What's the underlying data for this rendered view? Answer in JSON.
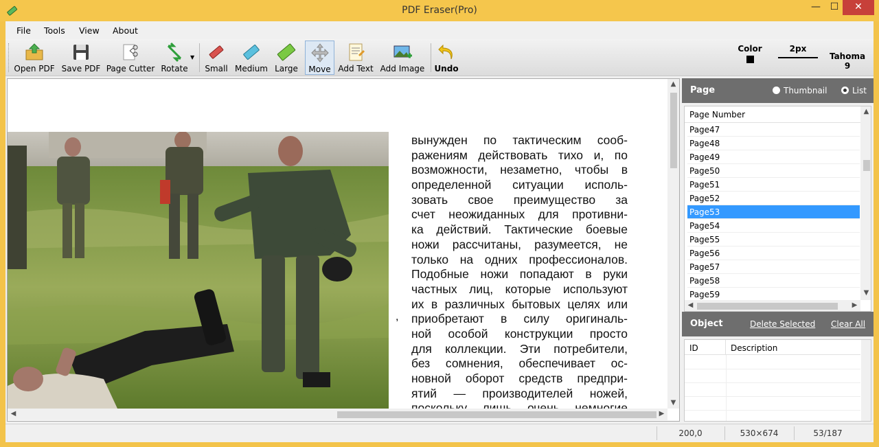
{
  "window": {
    "title": "PDF Eraser(Pro)",
    "minimize": "—",
    "maximize": "☐",
    "close": "✕"
  },
  "menu": [
    "File",
    "Tools",
    "View",
    "About"
  ],
  "toolbar": {
    "open_pdf": "Open PDF",
    "save_pdf": "Save PDF",
    "page_cutter": "Page Cutter",
    "rotate": "Rotate",
    "small": "Small",
    "medium": "Medium",
    "large": "Large",
    "move": "Move",
    "add_text": "Add Text",
    "add_image": "Add Image",
    "undo": "Undo",
    "color_label": "Color",
    "color_value": "#000000",
    "stroke_label": "2px",
    "font_label": "Tahoma 9"
  },
  "document": {
    "lines": [
      "вынужден по тактическим сооб-",
      "ражениям действовать тихо и, по",
      "возможности, незаметно, чтобы в",
      "определенной ситуации исполь-",
      "зовать свое преимущество за",
      "счет неожиданных для противни-",
      "ка действий. Тактические боевые",
      "ножи рассчитаны, разумеется, не",
      "только на одних профессионалов.",
      "Подобные ножи попадают в руки",
      "частных лиц, которые используют",
      "их в различных бытовых целях или",
      "приобретают в силу оригиналь-",
      "ной особой конструкции просто",
      "для коллекции. Эти потребители,",
      "без сомнения, обеспечивает ос-",
      "новной оборот средств предпри-",
      "ятий — производителей ножей,",
      "поскольку лишь очень немногие"
    ],
    "stray_comma": ","
  },
  "page_panel": {
    "title": "Page",
    "view_thumbnail": "Thumbnail",
    "view_list": "List",
    "selected_view": "List",
    "column_header": "Page Number",
    "pages": [
      "Page47",
      "Page48",
      "Page49",
      "Page50",
      "Page51",
      "Page52",
      "Page53",
      "Page54",
      "Page55",
      "Page56",
      "Page57",
      "Page58",
      "Page59"
    ],
    "selected_page": "Page53"
  },
  "object_panel": {
    "title": "Object",
    "delete_selected": "Delete Selected",
    "clear_all": "Clear All",
    "col_id": "ID",
    "col_description": "Description"
  },
  "status": {
    "coords": "200,0",
    "size": "530×674",
    "page": "53/187"
  },
  "colors": {
    "selection": "#3399ff",
    "panel_header": "#6e6e6e",
    "window_frame": "#f3c34a"
  }
}
